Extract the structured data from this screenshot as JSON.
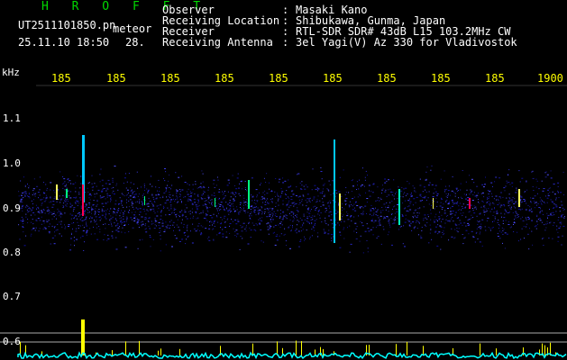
{
  "brand": "H R O F F T",
  "filename": "UT2511101850.pn",
  "label_meteor": "meteor",
  "datetime": "25.11.10 18:50",
  "meteor_count": "28.",
  "fields": [
    {
      "label": "Observer",
      "sep": ":",
      "value": "Masaki Kano"
    },
    {
      "label": "Receiving Location",
      "sep": ":",
      "value": "Shibukawa, Gunma, Japan"
    },
    {
      "label": "Receiver",
      "sep": ":",
      "value": "RTL-SDR SDR# 43dB L15 103.2MHz CW"
    },
    {
      "label": "Receiving Antenna",
      "sep": ":",
      "value": "3el Yagi(V) Az 330 for Vladivostok"
    }
  ],
  "y_axis_unit": "kHz",
  "y_ticks": [
    "1.1",
    "1.0",
    "0.9",
    "0.8",
    "0.7",
    "0.6"
  ],
  "x_ticks": [
    "185",
    "185",
    "185",
    "185",
    "185",
    "185",
    "185",
    "185",
    "185",
    "1900"
  ],
  "colors": {
    "background": "#000000",
    "brand": "#00d800",
    "ticks_x": "#ffff00",
    "text": "#ffffff",
    "echo_hot": "#ff0050",
    "baseline": "#00ffff"
  }
}
